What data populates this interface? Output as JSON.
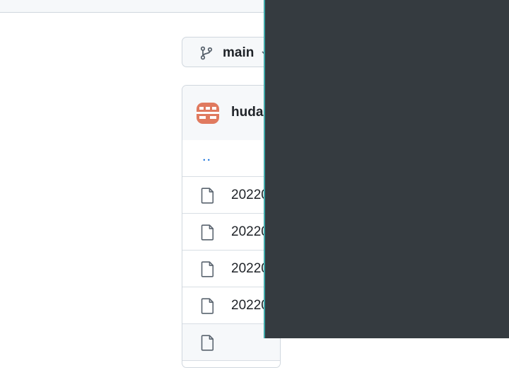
{
  "branch": {
    "name": "main"
  },
  "file_list": {
    "owner": "huda",
    "parent_link": "..",
    "files": [
      {
        "name": "20220"
      },
      {
        "name": "20220"
      },
      {
        "name": "20220"
      },
      {
        "name": "20220"
      }
    ]
  },
  "colors": {
    "overlay": "#353b40",
    "overlay_edge": "#3fa8a8",
    "link": "#0969da",
    "avatar": "#e07a5f"
  }
}
